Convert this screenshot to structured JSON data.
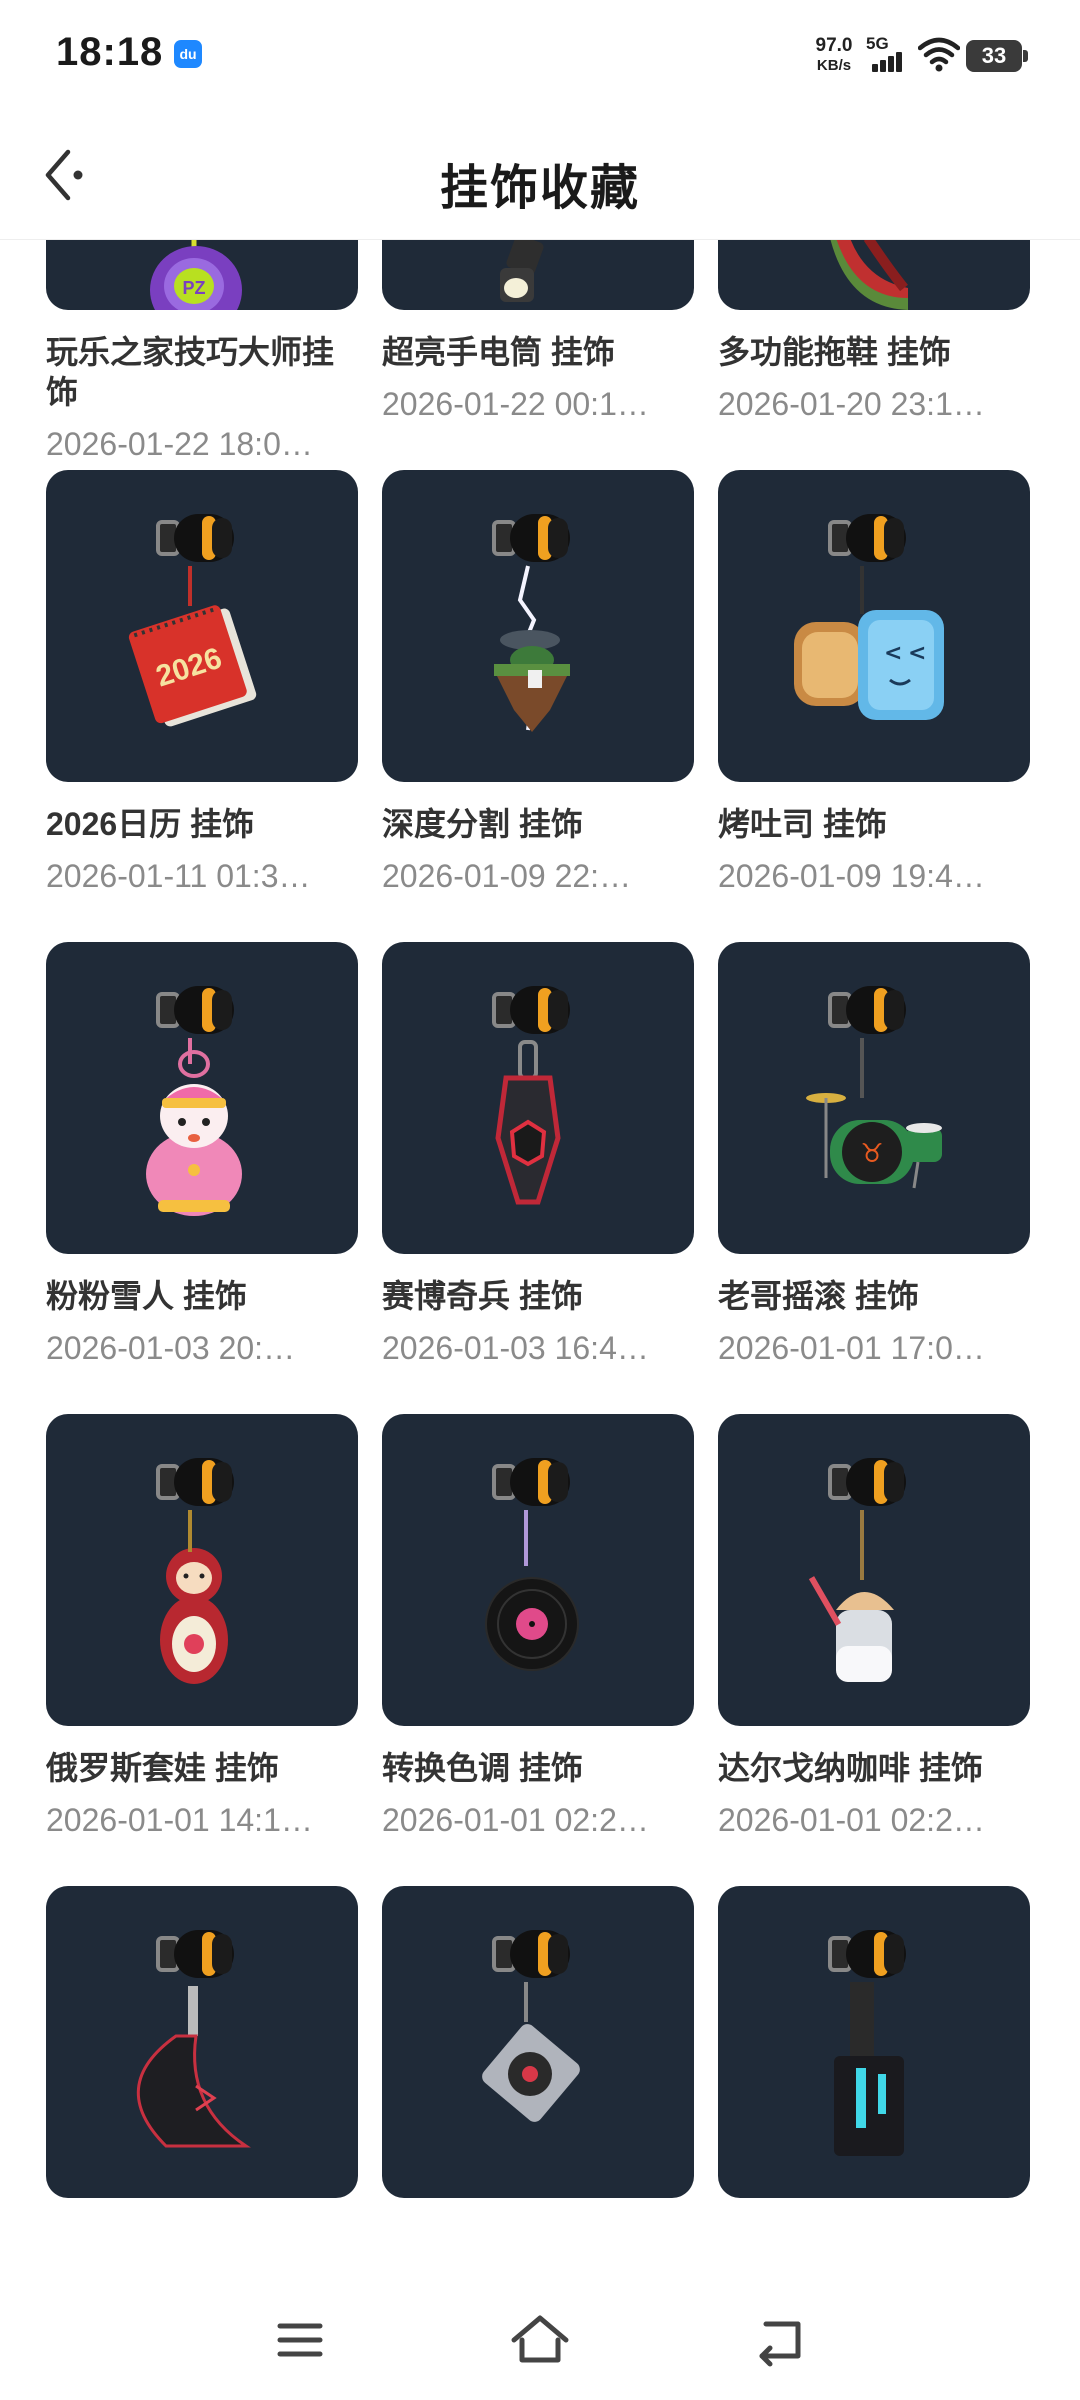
{
  "status_bar": {
    "time": "18:18",
    "app_badge": "du",
    "net_speed_value": "97.0",
    "net_speed_unit": "KB/s",
    "signal_label": "5G",
    "battery": "33"
  },
  "header": {
    "title": "挂饰收藏",
    "back_icon": "back-arrow-icon"
  },
  "items": [
    {
      "name": "玩乐之家技巧大师挂饰",
      "date": "2026-01-22 18:0…",
      "art": "yoyo"
    },
    {
      "name": "超亮手电筒 挂饰",
      "date": "2026-01-22 00:1…",
      "art": "flashlight"
    },
    {
      "name": "多功能拖鞋 挂饰",
      "date": "2026-01-20 23:1…",
      "art": "slipper"
    },
    {
      "name": "2026日历 挂饰",
      "date": "2026-01-11 01:3…",
      "art": "calendar"
    },
    {
      "name": "深度分割 挂饰",
      "date": "2026-01-09 22:…",
      "art": "island"
    },
    {
      "name": "烤吐司 挂饰",
      "date": "2026-01-09 19:4…",
      "art": "toast"
    },
    {
      "name": "粉粉雪人 挂饰",
      "date": "2026-01-03 20:…",
      "art": "snowman"
    },
    {
      "name": "赛博奇兵 挂饰",
      "date": "2026-01-03 16:4…",
      "art": "cyber"
    },
    {
      "name": "老哥摇滚 挂饰",
      "date": "2026-01-01 17:0…",
      "art": "drums"
    },
    {
      "name": "俄罗斯套娃 挂饰",
      "date": "2026-01-01 14:1…",
      "art": "matryoshka"
    },
    {
      "name": "转换色调 挂饰",
      "date": "2026-01-01 02:2…",
      "art": "vinyl"
    },
    {
      "name": "达尔戈纳咖啡 挂饰",
      "date": "2026-01-01 02:2…",
      "art": "coffee"
    },
    {
      "name": "",
      "date": "",
      "art": "blade"
    },
    {
      "name": "",
      "date": "",
      "art": "turntable"
    },
    {
      "name": "",
      "date": "",
      "art": "tower"
    }
  ],
  "nav_bar": {
    "menu_icon": "menu-icon",
    "home_icon": "home-icon",
    "back_icon": "back-icon"
  },
  "colors": {
    "tile_bg": "#1f2a38",
    "title_text": "#1a1a1a",
    "name_text": "#333333",
    "date_text": "#8a8a8a",
    "accent_orange": "#f0a020"
  }
}
